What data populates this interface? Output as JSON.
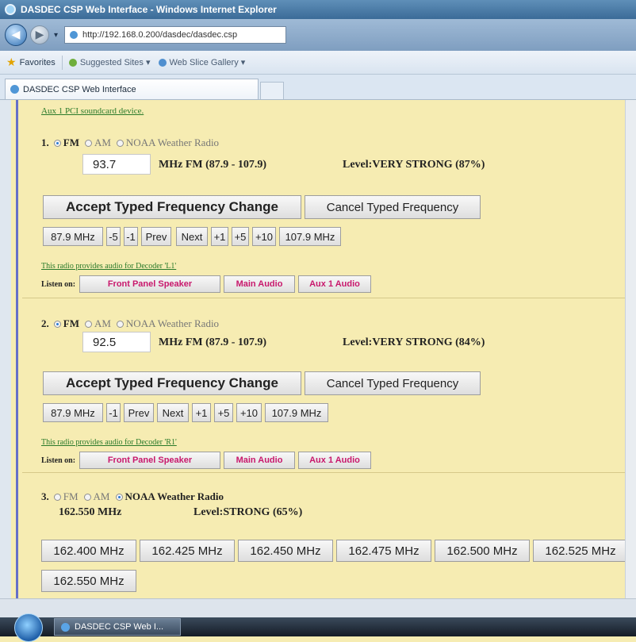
{
  "window": {
    "title": "DASDEC CSP Web Interface - Windows Internet Explorer"
  },
  "address": {
    "url": "http://192.168.0.200/dasdec/dasdec.csp"
  },
  "favorites": {
    "label": "Favorites",
    "items": [
      "Suggested Sites ▾",
      "Web Slice Gallery ▾"
    ]
  },
  "tab": {
    "label": "DASDEC CSP Web Interface"
  },
  "aux_link": "Aux 1 PCI soundcard device.",
  "radios": [
    {
      "number": "1.",
      "options": [
        "FM",
        "AM",
        "NOAA Weather Radio"
      ],
      "selected": "FM",
      "freq_value": "93.7",
      "mhz_text": "MHz FM (87.9 - 107.9)",
      "level_text": "Level:VERY STRONG  (87%)",
      "accept_label": "Accept Typed Frequency Change",
      "cancel_label": "Cancel Typed Frequency",
      "step_buttons": [
        "87.9 MHz",
        "-5",
        "-1",
        "Prev",
        "Next",
        "+1",
        "+5",
        "+10",
        "107.9 MHz"
      ],
      "decoder_text": "This radio provides audio for Decoder 'L1'",
      "listen_label": "Listen on:",
      "listen_buttons": [
        "Front Panel Speaker",
        "Main Audio",
        "Aux 1 Audio"
      ]
    },
    {
      "number": "2.",
      "options": [
        "FM",
        "AM",
        "NOAA Weather Radio"
      ],
      "selected": "FM",
      "freq_value": "92.5",
      "mhz_text": "MHz FM (87.9 - 107.9)",
      "level_text": "Level:VERY STRONG  (84%)",
      "accept_label": "Accept Typed Frequency Change",
      "cancel_label": "Cancel Typed Frequency",
      "step_buttons": [
        "87.9 MHz",
        "-1",
        "Prev",
        "Next",
        "+1",
        "+5",
        "+10",
        "107.9 MHz"
      ],
      "decoder_text": "This radio provides audio for Decoder 'R1'",
      "listen_label": "Listen on:",
      "listen_buttons": [
        "Front Panel Speaker",
        "Main Audio",
        "Aux 1 Audio"
      ]
    },
    {
      "number": "3.",
      "options": [
        "FM",
        "AM",
        "NOAA Weather Radio"
      ],
      "selected": "NOAA Weather Radio",
      "freq_text": "162.550 MHz",
      "level_text": "Level:STRONG  (65%)",
      "channels": [
        "162.400 MHz",
        "162.425 MHz",
        "162.450 MHz",
        "162.475 MHz",
        "162.500 MHz",
        "162.525 MHz",
        "162.550 MHz"
      ]
    }
  ],
  "taskbar": {
    "item_label": "DASDEC CSP Web I..."
  }
}
